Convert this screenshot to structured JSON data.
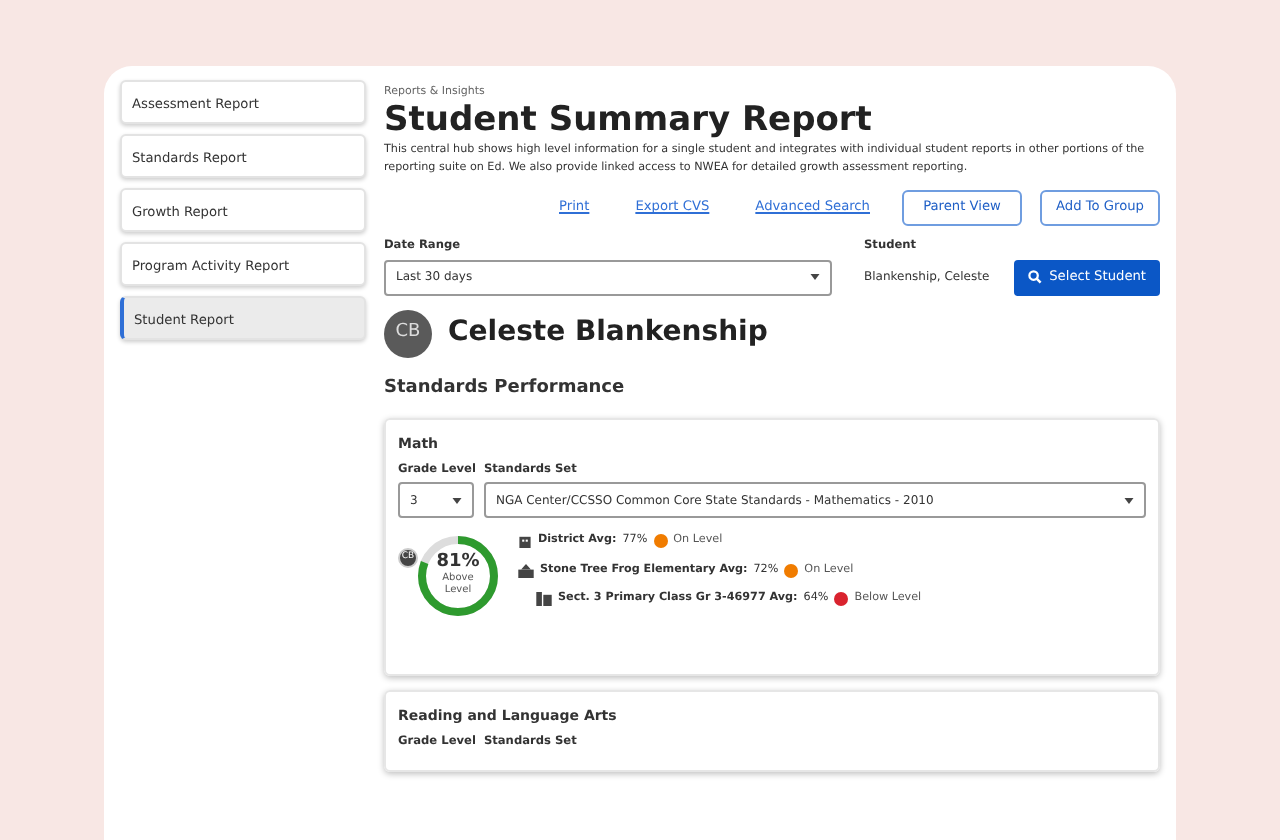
{
  "sidebar": {
    "items": [
      {
        "label": "Assessment Report",
        "selected": false
      },
      {
        "label": "Standards Report",
        "selected": false
      },
      {
        "label": "Growth Report",
        "selected": false
      },
      {
        "label": "Program Activity Report",
        "selected": false
      },
      {
        "label": "Student Report",
        "selected": true
      }
    ]
  },
  "breadcrumb": "Reports & Insights",
  "title": "Student Summary Report",
  "description": "This central hub shows high level information for a single student and integrates with individual student reports in other portions of the reporting suite on Ed. We also provide linked access to NWEA for detailed growth assessment reporting.",
  "actions": [
    {
      "kind": "link",
      "label": "Print"
    },
    {
      "kind": "link",
      "label": "Export CVS"
    },
    {
      "kind": "link",
      "label": "Advanced Search"
    },
    {
      "kind": "outline",
      "label": "Parent View"
    },
    {
      "kind": "outline",
      "label": "Add To Group"
    }
  ],
  "date_range": {
    "label": "Date Range",
    "value": "Last 30 days"
  },
  "student": {
    "label": "Student",
    "value": "Blankenship, Celeste",
    "button": "Select Student"
  },
  "profile": {
    "initials": "CB",
    "name": "Celeste Blankenship"
  },
  "section_title": "Standards Performance",
  "subjects": [
    {
      "name": "Math",
      "grade_label": "Grade Level",
      "grade": "3",
      "set_label": "Standards Set",
      "set": "NGA Center/CCSSO Common Core State Standards - Mathematics - 2010",
      "score": {
        "marker": "CB",
        "percent": "81%",
        "caption": "Above Level",
        "level": 0.81
      },
      "averages": [
        {
          "kind": "district",
          "label": "District Avg:",
          "value": "77%",
          "status": "On Level",
          "color": "#f07c00"
        },
        {
          "kind": "school",
          "label": "Stone Tree Frog Elementary Avg:",
          "value": "72%",
          "status": "On Level",
          "color": "#f07c00"
        },
        {
          "kind": "class",
          "label": "Sect. 3 Primary Class Gr 3-46977 Avg:",
          "value": "64%",
          "status": "Below Level",
          "color": "#d9232e"
        }
      ]
    },
    {
      "name": "Reading and Language Arts",
      "grade_label": "Grade Level",
      "set_label": "Standards Set"
    }
  ]
}
